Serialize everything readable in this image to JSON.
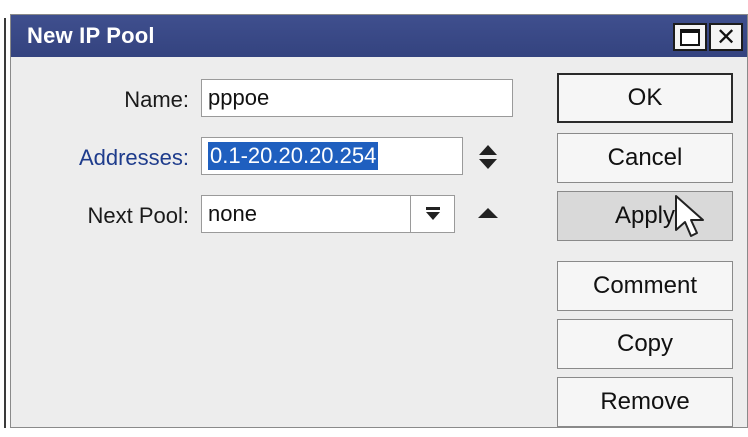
{
  "window": {
    "title": "New IP Pool"
  },
  "form": {
    "name": {
      "label": "Name:",
      "value": "pppoe"
    },
    "addresses": {
      "label": "Addresses:",
      "value": "0.1-20.20.20.254"
    },
    "next_pool": {
      "label": "Next Pool:",
      "value": "none"
    }
  },
  "buttons": {
    "ok": "OK",
    "cancel": "Cancel",
    "apply": "Apply",
    "comment": "Comment",
    "copy": "Copy",
    "remove": "Remove"
  },
  "icons": {
    "maximize": "maximize-icon",
    "close": "close-icon",
    "up_down": "up-down-arrows-icon",
    "dropdown": "dropdown-arrow-icon",
    "collapse": "up-triangle-icon",
    "cursor": "mouse-pointer-icon"
  },
  "colors": {
    "titlebar": "#3a4887",
    "selection": "#1f5fbf",
    "label_highlight": "#1e3c8c"
  }
}
